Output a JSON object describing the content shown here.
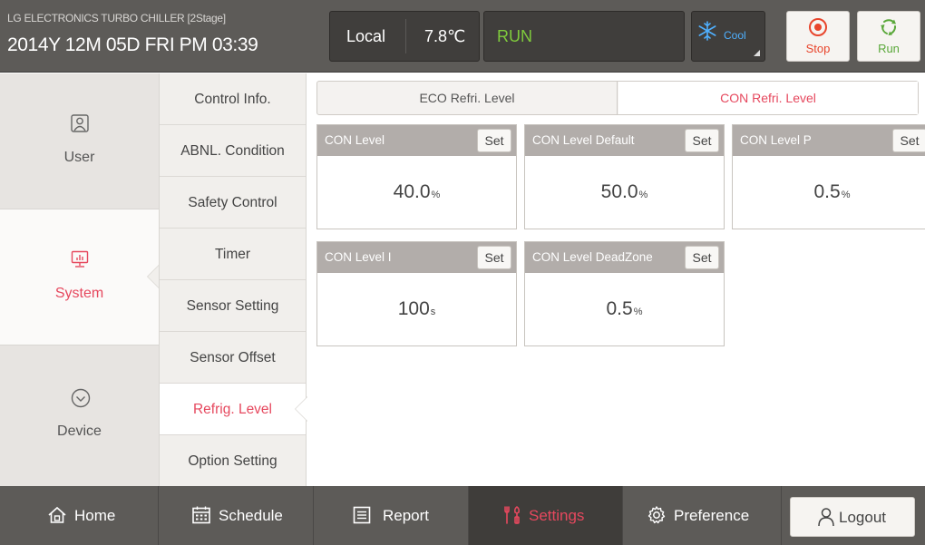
{
  "header": {
    "title": "LG ELECTRONICS TURBO CHILLER [2Stage]",
    "datetime": "2014Y 12M 05D  FRI PM 03:39",
    "mode": "Local",
    "temperature": "7.8℃",
    "run_status": "RUN",
    "cool_label": "Cool",
    "stop_label": "Stop",
    "run_label": "Run"
  },
  "leftnav": {
    "items": [
      {
        "label": "User",
        "icon": "user-icon"
      },
      {
        "label": "System",
        "icon": "system-monitor-icon"
      },
      {
        "label": "Device",
        "icon": "check-circle-icon"
      }
    ]
  },
  "subnav": {
    "items": [
      {
        "label": "Control Info."
      },
      {
        "label": "ABNL. Condition"
      },
      {
        "label": "Safety Control"
      },
      {
        "label": "Timer"
      },
      {
        "label": "Sensor Setting"
      },
      {
        "label": "Sensor Offset"
      },
      {
        "label": "Refrig. Level"
      },
      {
        "label": "Option Setting"
      }
    ]
  },
  "tabs": [
    {
      "label": "ECO Refri. Level"
    },
    {
      "label": "CON Refri. Level"
    }
  ],
  "cards": [
    {
      "title": "CON Level",
      "set_label": "Set",
      "value": "40.0",
      "unit": "%"
    },
    {
      "title": "CON Level Default",
      "set_label": "Set",
      "value": "50.0",
      "unit": "%"
    },
    {
      "title": "CON Level P",
      "set_label": "Set",
      "value": "0.5",
      "unit": "%"
    },
    {
      "title": "CON Level I",
      "set_label": "Set",
      "value": "100",
      "unit": "s"
    },
    {
      "title": "CON Level DeadZone",
      "set_label": "Set",
      "value": "0.5",
      "unit": "%"
    }
  ],
  "bottomnav": {
    "items": [
      {
        "label": "Home",
        "icon": "home-icon"
      },
      {
        "label": "Schedule",
        "icon": "calendar-icon"
      },
      {
        "label": "Report",
        "icon": "report-icon"
      },
      {
        "label": "Settings",
        "icon": "settings-icon"
      },
      {
        "label": "Preference",
        "icon": "gear-icon"
      }
    ],
    "logout_label": "Logout"
  },
  "colors": {
    "accent": "#e6485e",
    "header_bg": "#5d5b58",
    "run_green": "#7fca3c",
    "cool_blue": "#4fb0ff"
  }
}
